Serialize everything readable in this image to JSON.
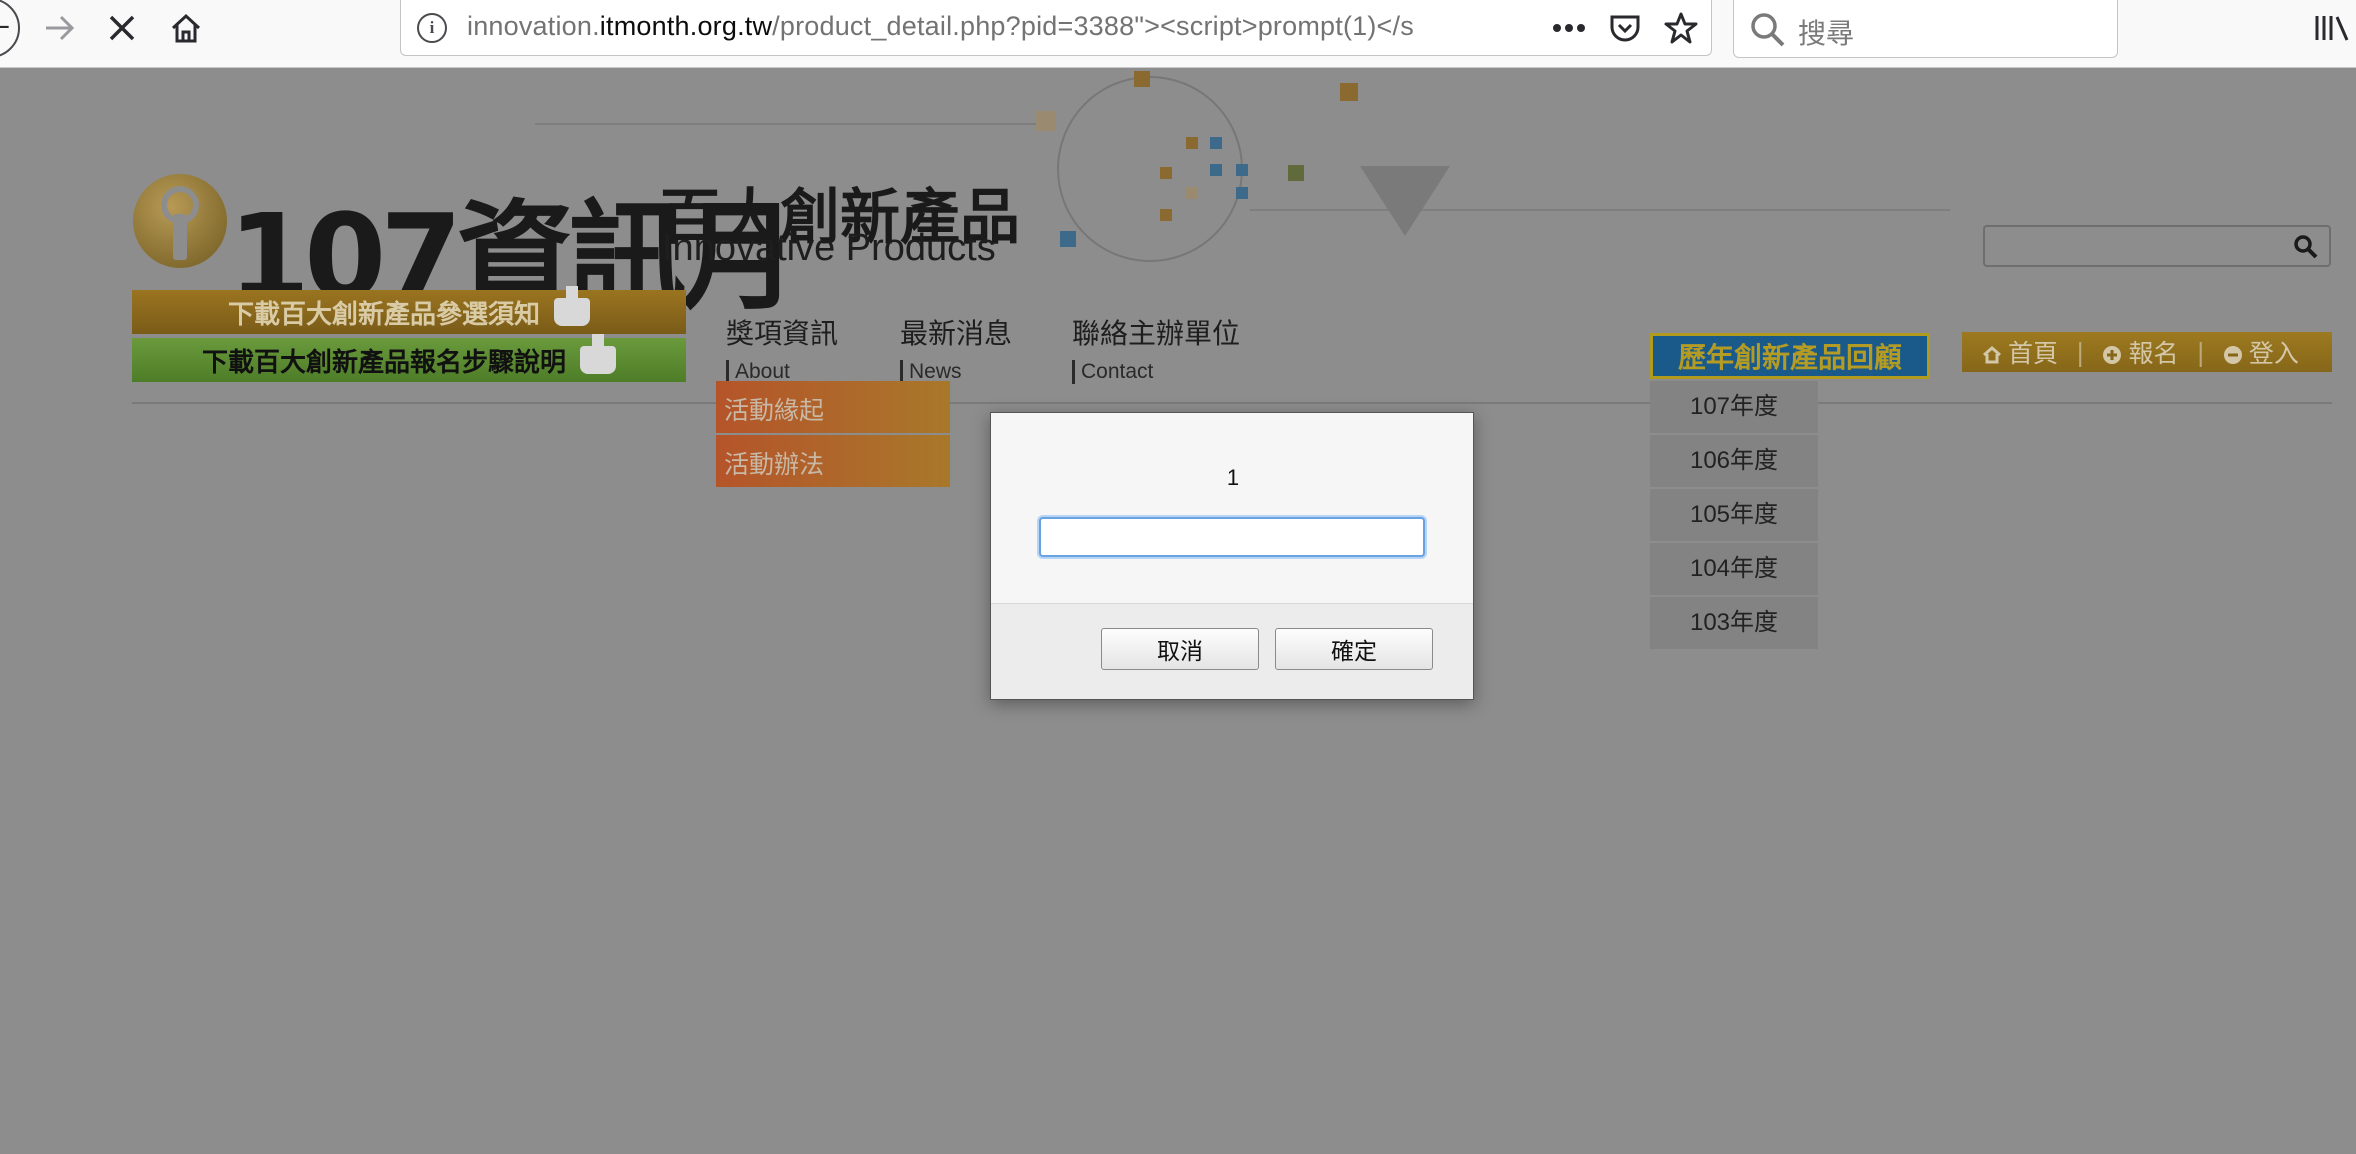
{
  "browser": {
    "url_prefix": "innovation.",
    "url_domain": "itmonth.org.tw",
    "url_rest": "/product_detail.php?pid=3388\"><script>prompt(1)</s",
    "search_placeholder": "搜尋",
    "icons": [
      "back-icon",
      "forward-icon",
      "stop-icon",
      "home-icon",
      "info-icon",
      "more-icon",
      "pocket-icon",
      "bookmark-star-icon",
      "search-icon",
      "library-icon"
    ]
  },
  "site": {
    "logo_main": "107資訊月",
    "logo_sub": "百大創新產品",
    "logo_en": "Innovative Products",
    "download_1": "下載百大創新產品參選須知",
    "download_2": "下載百大創新產品報名步驟說明",
    "nav": [
      {
        "zh": "獎項資訊",
        "en": "About"
      },
      {
        "zh": "最新消息",
        "en": "News"
      },
      {
        "zh": "聯絡主辦單位",
        "en": "Contact"
      }
    ],
    "submenu": [
      "活動緣起",
      "活動辦法"
    ],
    "history_label": "歷年創新產品回顧",
    "years": [
      "107年度",
      "106年度",
      "105年度",
      "104年度",
      "103年度"
    ],
    "links": {
      "home": "首頁",
      "register": "報名",
      "login": "登入"
    }
  },
  "dialog": {
    "message": "1",
    "input_value": "",
    "cancel_label": "取消",
    "ok_label": "確定"
  }
}
